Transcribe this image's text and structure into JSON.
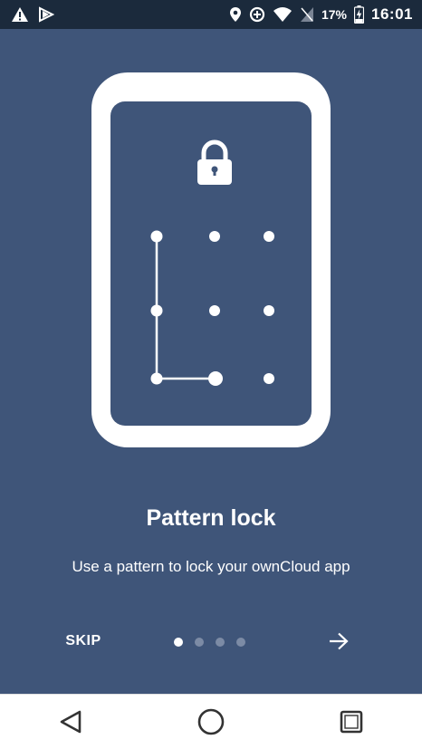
{
  "status_bar": {
    "battery_percent": "17%",
    "time": "16:01",
    "icons": [
      "warning-icon",
      "play-store-icon",
      "location-icon",
      "data-saver-icon",
      "wifi-icon",
      "no-sim-icon",
      "battery-charging-icon"
    ]
  },
  "onboarding": {
    "title": "Pattern lock",
    "subtitle": "Use a pattern to lock your ownCloud app",
    "skip_label": "SKIP",
    "page_count": 4,
    "current_page": 1
  },
  "nav_bar": {
    "icons": [
      "back-icon",
      "home-icon",
      "recents-icon"
    ]
  },
  "colors": {
    "background": "#3f5579",
    "status_bar": "#1b2a3c",
    "accent": "#ffffff",
    "dot_inactive": "#7c8ba5"
  }
}
